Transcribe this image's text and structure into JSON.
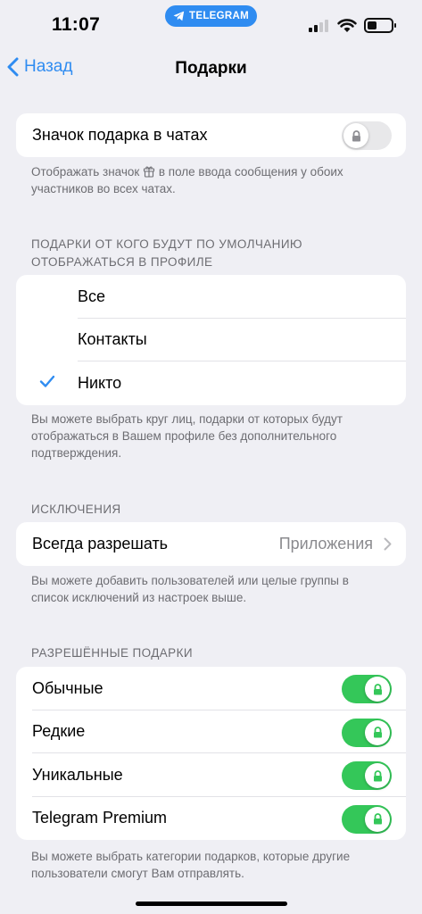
{
  "status_bar": {
    "time": "11:07",
    "app_pill": "TELEGRAM",
    "icons": [
      "cellular-signal-icon",
      "wifi-icon",
      "battery-icon"
    ]
  },
  "nav": {
    "back_label": "Назад",
    "title": "Подарки"
  },
  "gift_icon_setting": {
    "label": "Значок подарка в чатах",
    "enabled": false,
    "locked": true,
    "footer_before": "Отображать значок",
    "footer_after": "в поле ввода сообщения у обоих участников во всех чатах."
  },
  "visibility": {
    "header": "ПОДАРКИ ОТ КОГО БУДУТ ПО УМОЛЧАНИЮ ОТОБРАЖАТЬСЯ В ПРОФИЛЕ",
    "options": [
      {
        "label": "Все",
        "selected": false
      },
      {
        "label": "Контакты",
        "selected": false
      },
      {
        "label": "Никто",
        "selected": true
      }
    ],
    "footer": "Вы можете выбрать круг лиц, подарки от которых будут отображаться в Вашем профиле без дополнительного подтверждения."
  },
  "exceptions": {
    "header": "ИСКЛЮЧЕНИЯ",
    "always_allow_label": "Всегда разрешать",
    "always_allow_value": "Приложения",
    "footer": "Вы можете добавить пользователей или целые группы в список исключений из настроек выше."
  },
  "allowed_gifts": {
    "header": "РАЗРЕШЁННЫЕ ПОДАРКИ",
    "items": [
      {
        "label": "Обычные",
        "enabled": true,
        "locked": true
      },
      {
        "label": "Редкие",
        "enabled": true,
        "locked": true
      },
      {
        "label": "Уникальные",
        "enabled": true,
        "locked": true
      },
      {
        "label": "Telegram Premium",
        "enabled": true,
        "locked": true
      }
    ],
    "footer": "Вы можете выбрать категории подарков, которые другие пользователи смогут Вам отправлять."
  },
  "colors": {
    "accent": "#2f8cf1",
    "toggle_on": "#34c759",
    "background": "#efeff4",
    "secondary_text": "#6d6d72"
  }
}
